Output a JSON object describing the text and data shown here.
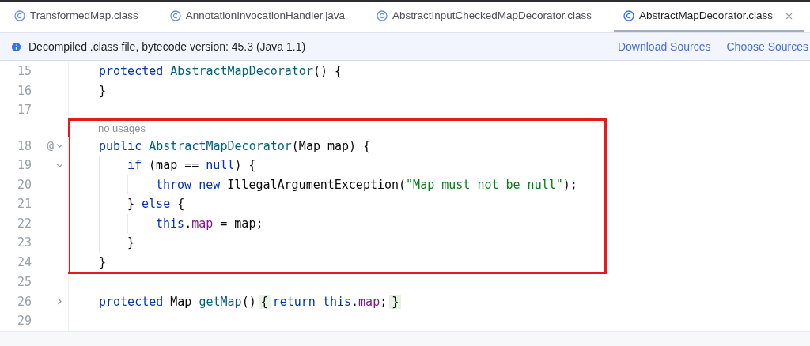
{
  "tabs": [
    {
      "label": "TransformedMap.class",
      "selected": false,
      "closable": false
    },
    {
      "label": "AnnotationInvocationHandler.java",
      "selected": false,
      "closable": false
    },
    {
      "label": "AbstractInputCheckedMapDecorator.class",
      "selected": false,
      "closable": false
    },
    {
      "label": "AbstractMapDecorator.class",
      "selected": true,
      "closable": true
    }
  ],
  "banner": {
    "message": "Decompiled .class file, bytecode version: 45.3 (Java 1.1)",
    "links": [
      "Download Sources",
      "Choose Sources"
    ]
  },
  "code": {
    "blocks": [
      {
        "boxed": false,
        "lines": [
          {
            "number": "15",
            "tokens": [
              {
                "kind": "keyword",
                "text": "protected"
              },
              {
                "kind": "method",
                "text": " AbstractMapDecorator"
              },
              {
                "kind": "plain",
                "text": "() {"
              }
            ]
          },
          {
            "number": "16",
            "tokens": [
              {
                "kind": "plain",
                "text": "}"
              }
            ]
          },
          {
            "number": "17"
          }
        ]
      },
      {
        "boxed": true,
        "hint": "no usages",
        "lines": [
          {
            "number": "18",
            "gutter_mark": "@",
            "collapsed": false,
            "tokens": [
              {
                "kind": "keyword",
                "text": "public"
              },
              {
                "kind": "method",
                "text": " AbstractMapDecorator"
              },
              {
                "kind": "plain",
                "text": "(Map map) {"
              }
            ],
            "children": [
              {
                "number": "19",
                "collapsed": false,
                "tokens": [
                  {
                    "kind": "keyword",
                    "text": "if"
                  },
                  {
                    "kind": "plain",
                    "text": " (map == "
                  },
                  {
                    "kind": "keyword",
                    "text": "null"
                  },
                  {
                    "kind": "plain",
                    "text": ") {"
                  }
                ],
                "children": [
                  {
                    "number": "20",
                    "tokens": [
                      {
                        "kind": "keyword",
                        "text": "throw new"
                      },
                      {
                        "kind": "plain",
                        "text": " IllegalArgumentException("
                      },
                      {
                        "kind": "string",
                        "text": "\"Map must not be null\""
                      },
                      {
                        "kind": "plain",
                        "text": ");"
                      }
                    ]
                  }
                ]
              },
              {
                "number": "21",
                "tokens": [
                  {
                    "kind": "plain",
                    "text": "} "
                  },
                  {
                    "kind": "keyword",
                    "text": "else"
                  },
                  {
                    "kind": "plain",
                    "text": " {"
                  }
                ],
                "children": [
                  {
                    "number": "22",
                    "tokens": [
                      {
                        "kind": "keyword",
                        "text": "this"
                      },
                      {
                        "kind": "plain",
                        "text": "."
                      },
                      {
                        "kind": "field",
                        "text": "map"
                      },
                      {
                        "kind": "plain",
                        "text": " = map;"
                      }
                    ]
                  }
                ]
              },
              {
                "number": "23",
                "tokens": [
                  {
                    "kind": "plain",
                    "text": "}"
                  }
                ]
              }
            ]
          },
          {
            "number": "24",
            "tokens": [
              {
                "kind": "plain",
                "text": "}"
              }
            ]
          }
        ]
      },
      {
        "boxed": false,
        "lines": [
          {
            "number": "25"
          },
          {
            "number": "26",
            "collapsed": true,
            "tokens": [
              {
                "kind": "keyword",
                "text": "protected"
              },
              {
                "kind": "plain",
                "text": " Map "
              },
              {
                "kind": "method",
                "text": "getMap"
              },
              {
                "kind": "plain",
                "text": "()"
              },
              {
                "kind": "folded",
                "text": "{"
              },
              {
                "kind": "keyword",
                "text": "return this"
              },
              {
                "kind": "plain",
                "text": "."
              },
              {
                "kind": "field",
                "text": "map"
              },
              {
                "kind": "plain",
                "text": ";"
              },
              {
                "kind": "folded",
                "text": "}"
              }
            ]
          },
          {
            "number": "29"
          }
        ]
      }
    ]
  }
}
